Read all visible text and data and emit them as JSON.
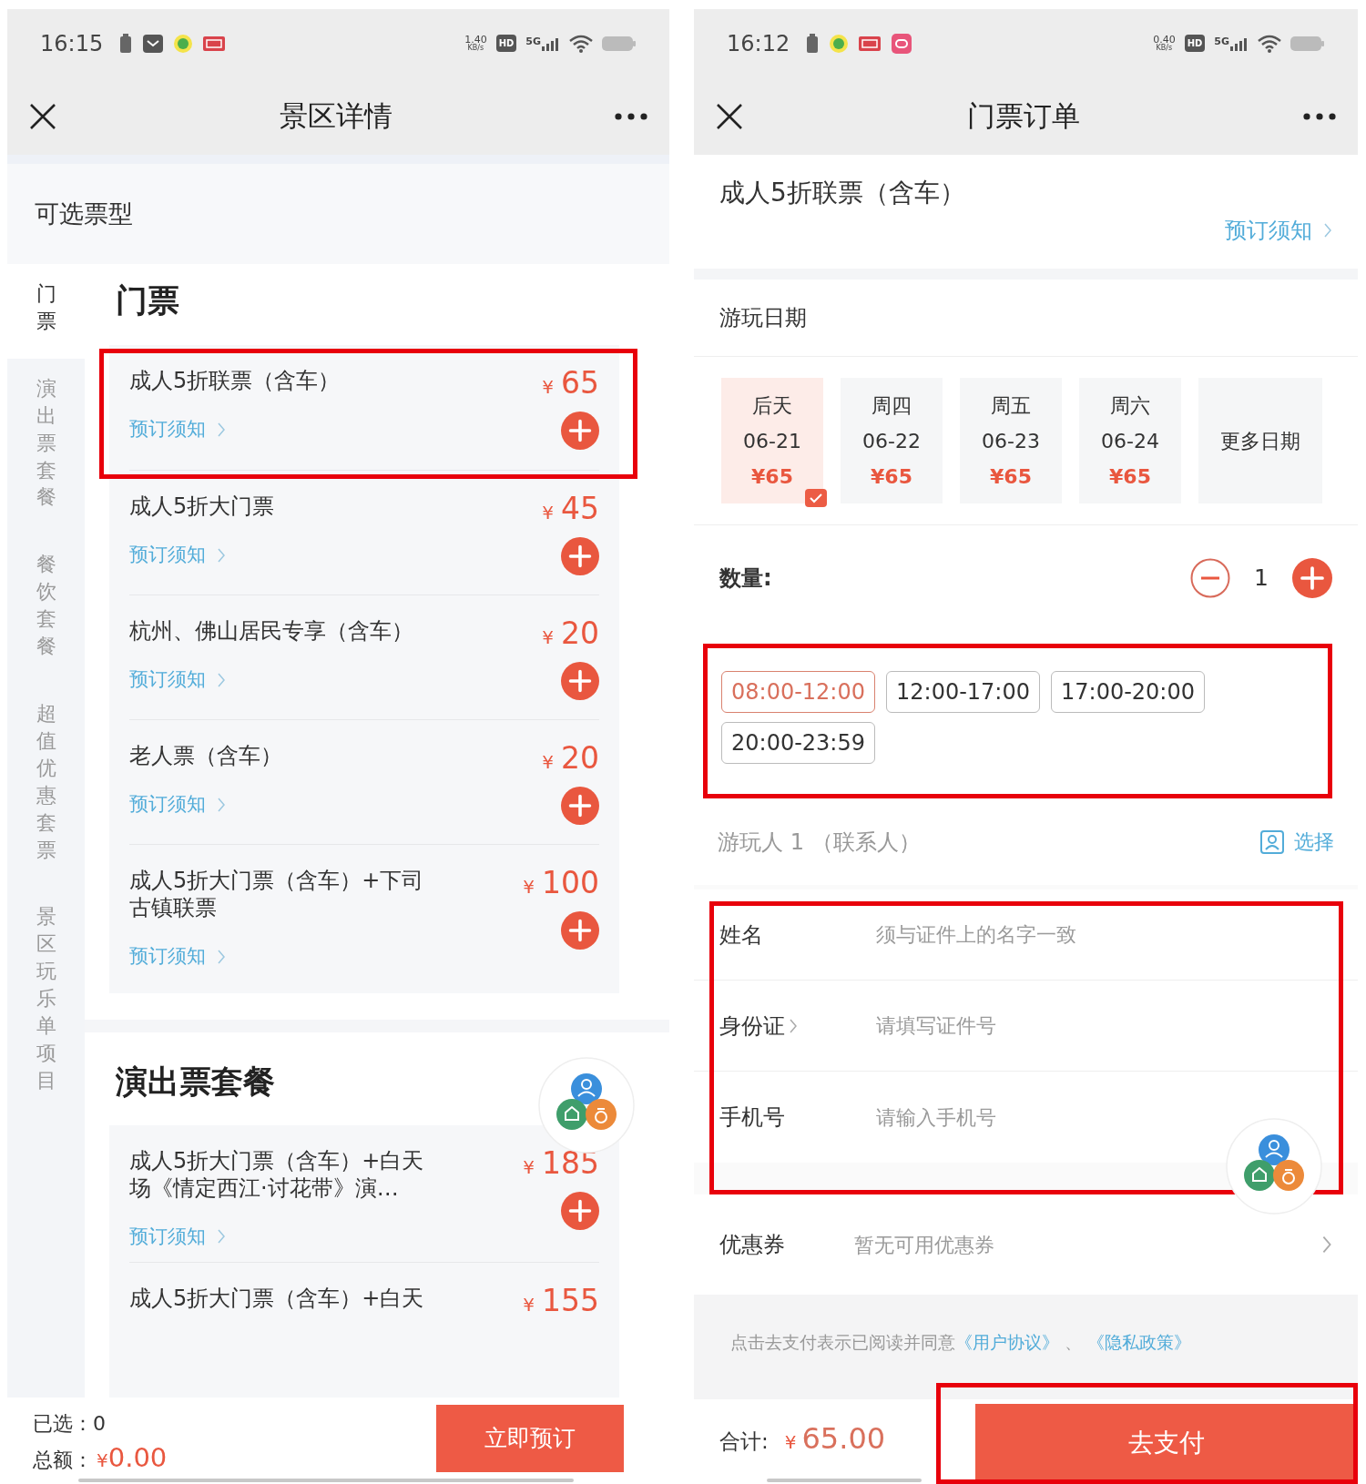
{
  "left_screen": {
    "status_bar": {
      "time": "16:15",
      "speed": "1.40",
      "speed_unit": "KB/s",
      "hd": "HD",
      "network": "5G",
      "notifications": [
        {
          "kind": "storage"
        },
        {
          "kind": "mail"
        },
        {
          "kind": "app"
        },
        {
          "kind": "badge"
        }
      ]
    },
    "nav": {
      "title": "景区详情"
    },
    "section_header": "可选票型",
    "category_tabs": [
      {
        "label": "门票",
        "selected": true
      },
      {
        "label": "演出票套餐",
        "selected": false
      },
      {
        "label": "餐饮套餐",
        "selected": false
      },
      {
        "label": "超值优惠套票",
        "selected": false
      },
      {
        "label": "景区玩乐单项目",
        "selected": false
      }
    ],
    "sections": [
      {
        "title": "门票",
        "tickets": [
          {
            "name_lines": [
              "成人5折联票（含车）"
            ],
            "currency": "¥",
            "price": "65",
            "notice": "预订须知",
            "add_button": true,
            "highlighted": true
          },
          {
            "name_lines": [
              "成人5折大门票"
            ],
            "currency": "¥",
            "price": "45",
            "notice": "预订须知",
            "add_button": true,
            "highlighted": false
          },
          {
            "name_lines": [
              "杭州、佛山居民专享（含车）"
            ],
            "currency": "¥",
            "price": "20",
            "notice": "预订须知",
            "add_button": true,
            "highlighted": false
          },
          {
            "name_lines": [
              "老人票（含车）"
            ],
            "currency": "¥",
            "price": "20",
            "notice": "预订须知",
            "add_button": true,
            "highlighted": false
          },
          {
            "name_lines": [
              "成人5折大门票（含车）+下司",
              "古镇联票"
            ],
            "currency": "¥",
            "price": "100",
            "notice": "预订须知",
            "add_button": true,
            "highlighted": false
          }
        ]
      },
      {
        "title": "演出票套餐",
        "tickets": [
          {
            "name_lines": [
              "成人5折大门票（含车）+白天",
              "场《情定西江·讨花带》演…"
            ],
            "currency": "¥",
            "price": "185",
            "notice": "预订须知",
            "add_button": true,
            "highlighted": false
          },
          {
            "name_lines": [
              "成人5折大门票（含车）+白天"
            ],
            "currency": "¥",
            "price": "155",
            "add_button": false,
            "highlighted": false
          }
        ]
      }
    ],
    "footer": {
      "selected_label": "已选：",
      "selected_count": "0",
      "total_label": "总额：",
      "currency": "¥",
      "total": "0.00",
      "button": "立即预订"
    }
  },
  "right_screen": {
    "status_bar": {
      "time": "16:12",
      "speed": "0.40",
      "speed_unit": "KB/s",
      "hd": "HD",
      "network": "5G",
      "notifications": [
        {
          "kind": "storage"
        },
        {
          "kind": "app"
        },
        {
          "kind": "badge"
        },
        {
          "kind": "pink"
        }
      ]
    },
    "nav": {
      "title": "门票订单"
    },
    "product": {
      "title": "成人5折联票（含车）",
      "notice": "预订须知"
    },
    "date_label": "游玩日期",
    "dates": [
      {
        "weekday": "后天",
        "date": "06-21",
        "price": "¥65",
        "selected": true
      },
      {
        "weekday": "周四",
        "date": "06-22",
        "price": "¥65",
        "selected": false
      },
      {
        "weekday": "周五",
        "date": "06-23",
        "price": "¥65",
        "selected": false
      },
      {
        "weekday": "周六",
        "date": "06-24",
        "price": "¥65",
        "selected": false
      }
    ],
    "more_dates": "更多日期",
    "quantity": {
      "label": "数量:",
      "value": "1"
    },
    "time_slots": {
      "highlighted": true,
      "slots": [
        {
          "label": "08:00-12:00",
          "selected": true
        },
        {
          "label": "12:00-17:00",
          "selected": false
        },
        {
          "label": "17:00-20:00",
          "selected": false
        },
        {
          "label": "20:00-23:59",
          "selected": false
        }
      ]
    },
    "visitor": {
      "label": "游玩人 1 （联系人）",
      "choose": "选择"
    },
    "form": {
      "highlighted": true,
      "fields": [
        {
          "label": "姓名",
          "placeholder": "须与证件上的名字一致",
          "chevron": false
        },
        {
          "label": "身份证",
          "placeholder": "请填写证件号",
          "chevron": true
        },
        {
          "label": "手机号",
          "placeholder": "请输入手机号",
          "chevron": false
        }
      ]
    },
    "coupon": {
      "label": "优惠券",
      "value": "暂无可用优惠券"
    },
    "agreement": {
      "text": "点击去支付表示已阅读并同意",
      "links": [
        "《用户协议》",
        "《隐私政策》"
      ],
      "separator": "、"
    },
    "footer": {
      "total_label": "合计:",
      "currency": "¥",
      "total": "65.00",
      "button": "去支付",
      "highlighted": true
    }
  }
}
